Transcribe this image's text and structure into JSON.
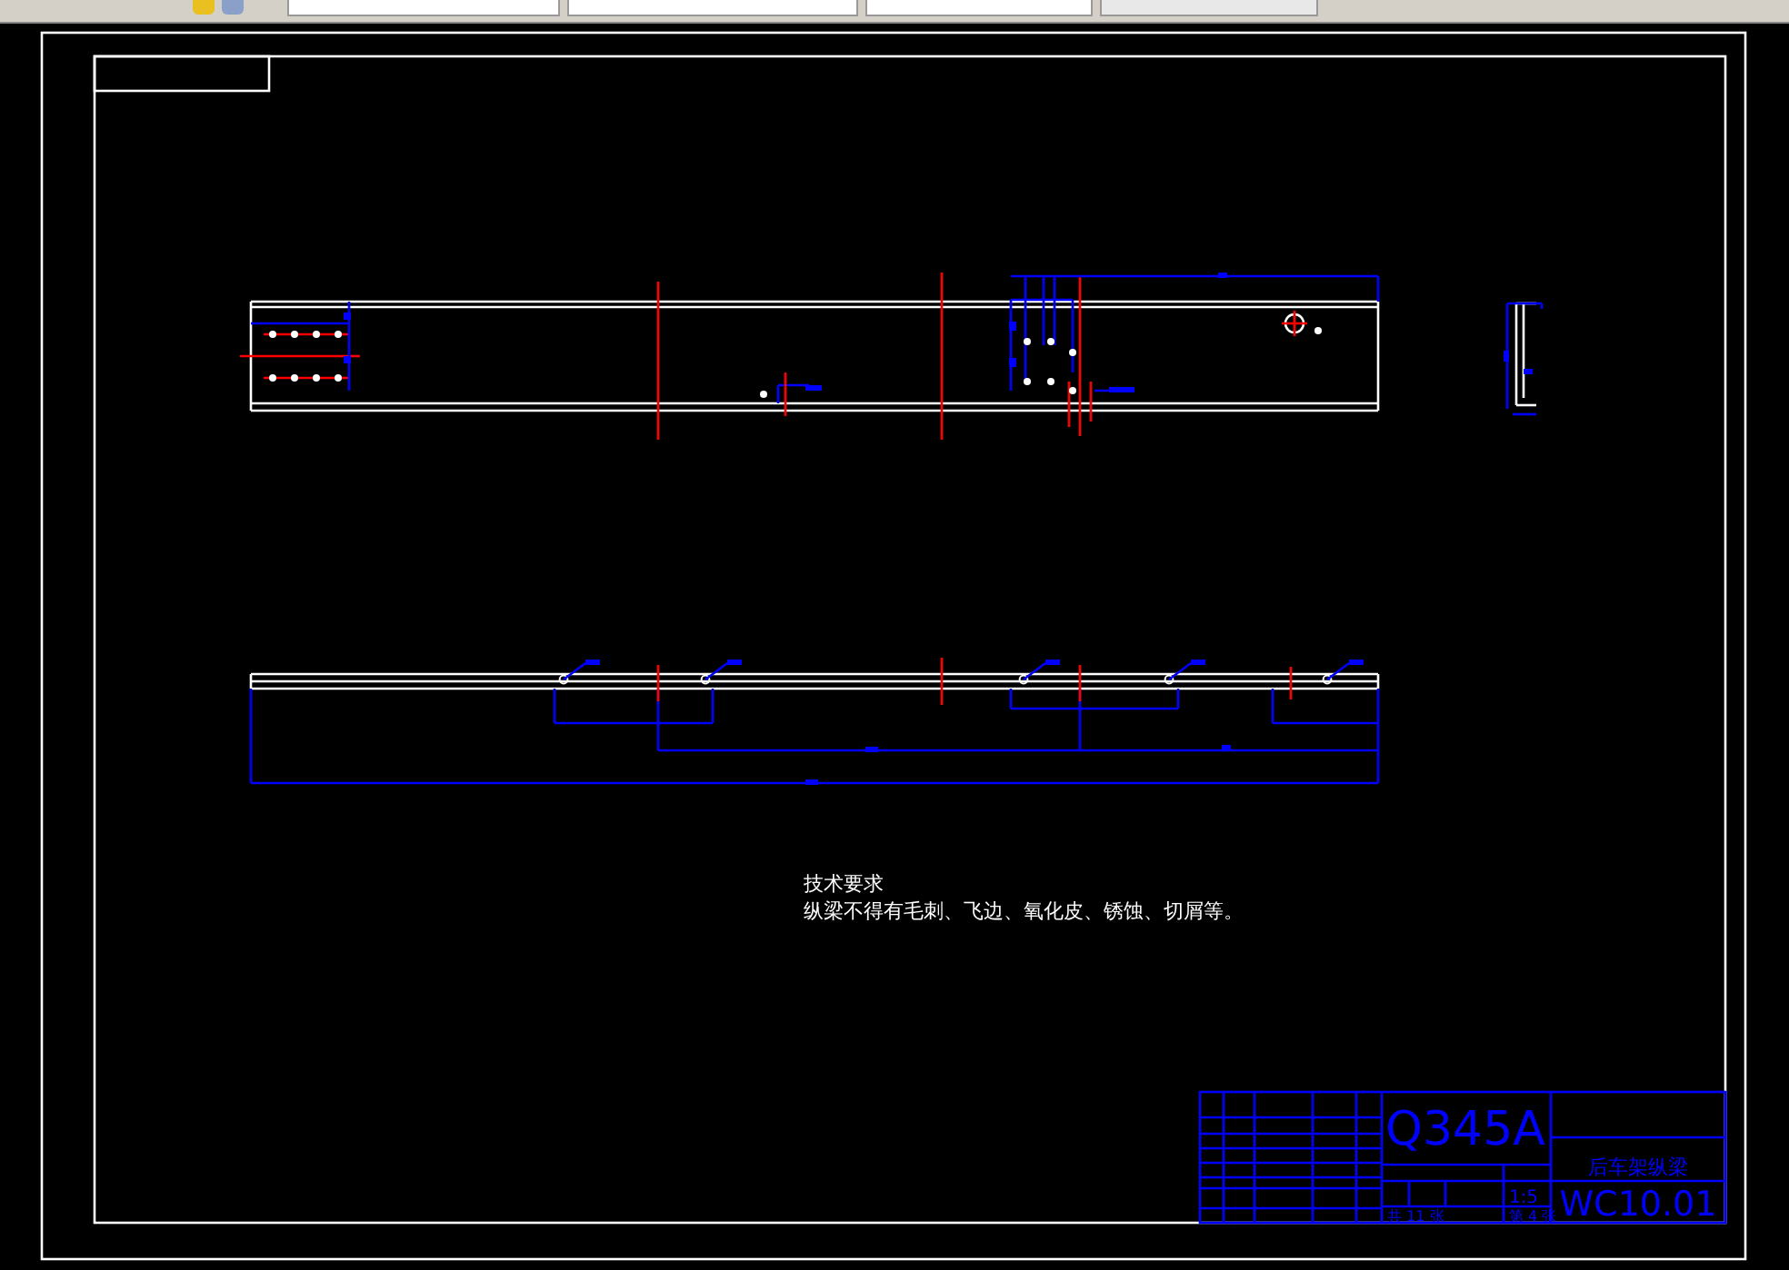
{
  "notes": {
    "title": "技术要求",
    "text": "纵梁不得有毛刺、飞边、氧化皮、锈蚀、切屑等。"
  },
  "title_block": {
    "material": "Q345A",
    "part_name": "后车架纵梁",
    "drawing_no": "WC10.01",
    "scale": "1:5",
    "sheets_total": "共 11 张",
    "sheet_no": "第 4 张"
  }
}
